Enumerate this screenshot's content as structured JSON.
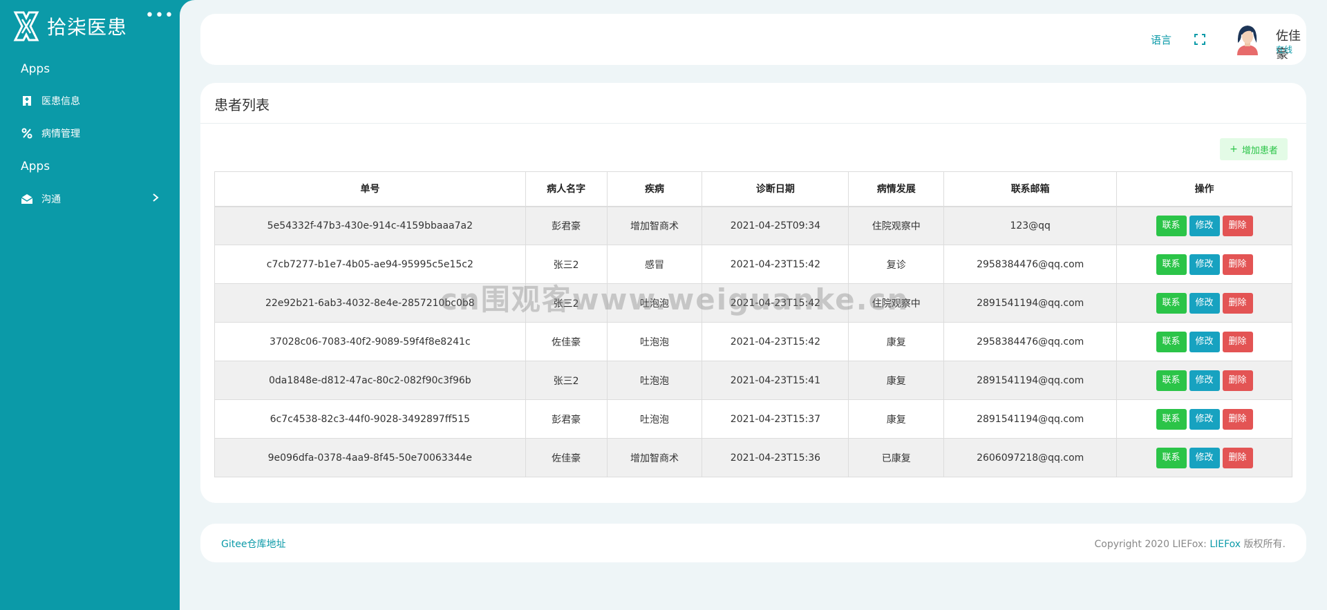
{
  "sidebar": {
    "brand": "拾柒医患",
    "more": "•••",
    "sections": [
      {
        "heading": "Apps"
      },
      {
        "heading": "Apps"
      }
    ],
    "items": [
      {
        "label": "医患信息",
        "icon": "hospital-icon"
      },
      {
        "label": "病情管理",
        "icon": "percent-icon"
      },
      {
        "label": "沟通",
        "icon": "mail-icon"
      }
    ]
  },
  "topbar": {
    "language": "语言",
    "user_name": "佐佳豪",
    "user_status": "在线"
  },
  "card": {
    "title": "患者列表",
    "add_button": "增加患者"
  },
  "table": {
    "headers": [
      "单号",
      "病人名字",
      "疾病",
      "诊断日期",
      "病情发展",
      "联系邮箱",
      "操作"
    ],
    "rows": [
      [
        "5e54332f-47b3-430e-914c-4159bbaaa7a2",
        "彭君豪",
        "增加智商术",
        "2021-04-25T09:34",
        "住院观察中",
        "123@qq"
      ],
      [
        "c7cb7277-b1e7-4b05-ae94-95995c5e15c2",
        "张三2",
        "感冒",
        "2021-04-23T15:42",
        "复诊",
        "2958384476@qq.com"
      ],
      [
        "22e92b21-6ab3-4032-8e4e-2857210bc0b8",
        "张三2",
        "吐泡泡",
        "2021-04-23T15:42",
        "住院观察中",
        "2891541194@qq.com"
      ],
      [
        "37028c06-7083-40f2-9089-59f4f8e8241c",
        "佐佳豪",
        "吐泡泡",
        "2021-04-23T15:42",
        "康复",
        "2958384476@qq.com"
      ],
      [
        "0da1848e-d812-47ac-80c2-082f90c3f96b",
        "张三2",
        "吐泡泡",
        "2021-04-23T15:41",
        "康复",
        "2891541194@qq.com"
      ],
      [
        "6c7c4538-82c3-44f0-9028-3492897ff515",
        "彭君豪",
        "吐泡泡",
        "2021-04-23T15:37",
        "康复",
        "2891541194@qq.com"
      ],
      [
        "9e096dfa-0378-4aa9-8f45-50e70063344e",
        "佐佳豪",
        "增加智商术",
        "2021-04-23T15:36",
        "已康复",
        "2606097218@qq.com"
      ]
    ],
    "actions": {
      "contact": "联系",
      "edit": "修改",
      "delete": "删除"
    }
  },
  "watermark": "cn围观客www.weiguanke.cn",
  "footer": {
    "gitee": "Gitee仓库地址",
    "copyright_prefix": "Copyright 2020 LIEFox: ",
    "copyright_brand": "LIEFox",
    "copyright_suffix": " 版权所有."
  },
  "colors": {
    "primary": "#0b9aa8",
    "contact": "#2bc448",
    "edit": "#17a2c0",
    "delete": "#e35454"
  }
}
